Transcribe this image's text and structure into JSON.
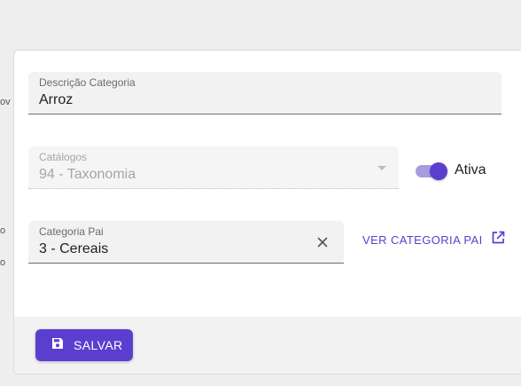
{
  "left_fragments": [
    "ov",
    "o",
    "o"
  ],
  "form": {
    "descricao": {
      "label": "Descrição Categoria",
      "value": "Arroz"
    },
    "catalogos": {
      "label": "Catálogos",
      "value": "94 - Taxonomia",
      "disabled": true
    },
    "ativa": {
      "label": "Ativa",
      "checked": true
    },
    "categoria_pai": {
      "label": "Categoria Pai",
      "value": "3 - Cereais"
    },
    "ver_categoria_label": "VER CATEGORIA PAI"
  },
  "footer": {
    "save_label": "SALVAR"
  },
  "colors": {
    "accent": "#5a3fcf",
    "accent_light": "#a89bdf"
  },
  "icons": [
    "clear-icon",
    "open-in-new-icon",
    "save-icon",
    "dropdown-caret-icon"
  ]
}
